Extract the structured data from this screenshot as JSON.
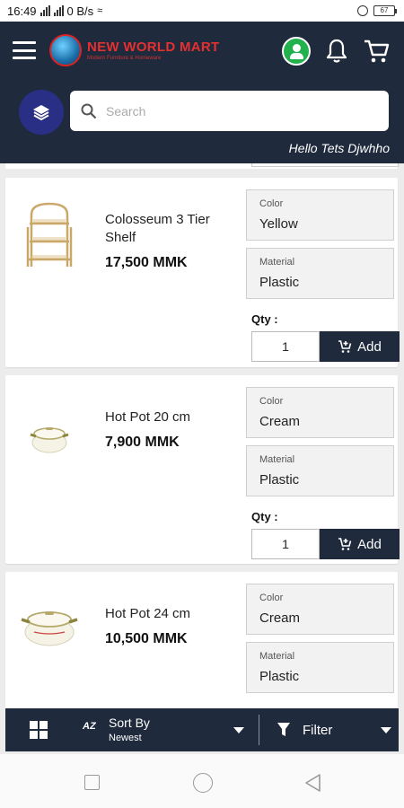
{
  "status_bar": {
    "time": "16:49",
    "network_speed": "0 B/s",
    "battery": "67"
  },
  "header": {
    "brand_name": "NEW WORLD MART",
    "brand_tagline": "Modern Furniture & Homeware",
    "search_placeholder": "Search",
    "greeting": "Hello Tets Djwhho"
  },
  "colors": {
    "header_bg": "#1f2a3c",
    "account_green": "#22b14c",
    "layers_button": "#2a2f86",
    "logo_red": "#e53030"
  },
  "products": [
    {
      "name": "Colosseum 3 Tier Shelf",
      "price": "17,500 MMK",
      "color_label": "Color",
      "color": "Yellow",
      "material_label": "Material",
      "material": "Plastic",
      "qty_label": "Qty :",
      "qty": "1",
      "add_label": "Add"
    },
    {
      "name": "Hot Pot 20 cm",
      "price": "7,900 MMK",
      "color_label": "Color",
      "color": "Cream",
      "material_label": "Material",
      "material": "Plastic",
      "qty_label": "Qty :",
      "qty": "1",
      "add_label": "Add"
    },
    {
      "name": "Hot Pot 24 cm",
      "price": "10,500 MMK",
      "color_label": "Color",
      "color": "Cream",
      "material_label": "Material",
      "material": "Plastic"
    }
  ],
  "toolbar": {
    "az_label": "AZ",
    "sort_title": "Sort By",
    "sort_value": "Newest",
    "filter_label": "Filter"
  },
  "icons": {
    "menu": "hamburger-menu-icon",
    "account": "account-icon",
    "notifications": "bell-icon",
    "cart": "cart-icon",
    "categories": "layers-icon",
    "search": "search-icon",
    "add_to_cart": "cart-plus-icon",
    "grid_view": "grid-icon",
    "sort": "az-sort-icon",
    "filter": "filter-icon"
  }
}
